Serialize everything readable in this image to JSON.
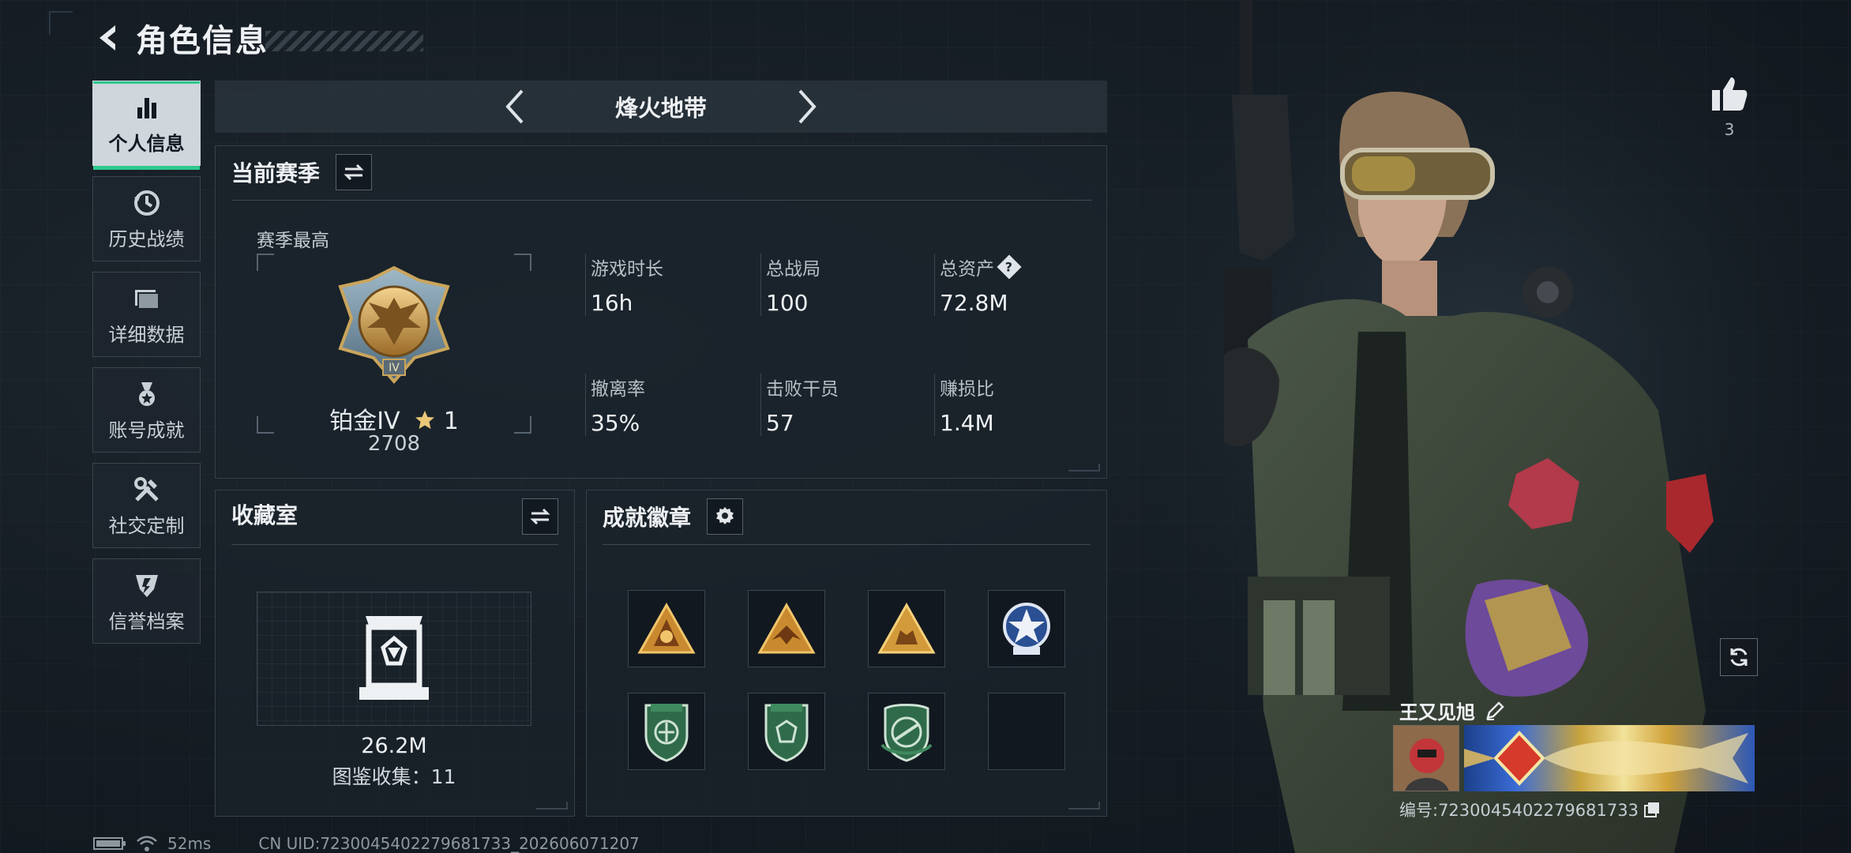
{
  "header": {
    "title": "角色信息"
  },
  "nav": {
    "items": [
      {
        "label": "个人信息",
        "icon": "bar-chart-icon",
        "active": true
      },
      {
        "label": "历史战绩",
        "icon": "history-clock-icon",
        "active": false
      },
      {
        "label": "详细数据",
        "icon": "folder-icon",
        "active": false
      },
      {
        "label": "账号成就",
        "icon": "medal-icon",
        "active": false
      },
      {
        "label": "社交定制",
        "icon": "tools-icon",
        "active": false
      },
      {
        "label": "信誉档案",
        "icon": "credit-shield-icon",
        "active": false
      }
    ]
  },
  "mode": {
    "title": "烽火地带"
  },
  "season": {
    "title": "当前赛季",
    "subtitle": "赛季最高",
    "rank_name": "铂金IV",
    "rank_stars": "1",
    "rank_score": "2708",
    "stats": [
      {
        "label": "游戏时长",
        "value": "16h"
      },
      {
        "label": "总战局",
        "value": "100"
      },
      {
        "label": "总资产",
        "value": "72.8M",
        "help": true
      },
      {
        "label": "撤离率",
        "value": "35%"
      },
      {
        "label": "击败干员",
        "value": "57"
      },
      {
        "label": "赚损比",
        "value": "1.4M"
      }
    ]
  },
  "collection": {
    "title": "收藏室",
    "value": "26.2M",
    "count_text": "图鉴收集：11"
  },
  "badges": {
    "title": "成就徽章",
    "slots": [
      "gold-triangle-badge",
      "gold-triangle-wings-badge",
      "gold-triangle-beast-badge",
      "blue-star-badge",
      "green-shield-badge",
      "green-shield-helmet-badge",
      "green-shield-gun-badge",
      "empty-slot"
    ]
  },
  "profile": {
    "likes": "3",
    "name": "王又见旭",
    "id_text": "编号:7230045402279681733"
  },
  "statusbar": {
    "ping": "52ms",
    "uid": "CN UID:7230045402279681733_202606071207"
  },
  "colors": {
    "accent": "#2fc88e",
    "panel": "#1b232b",
    "active_nav": "#cfd6dc"
  }
}
